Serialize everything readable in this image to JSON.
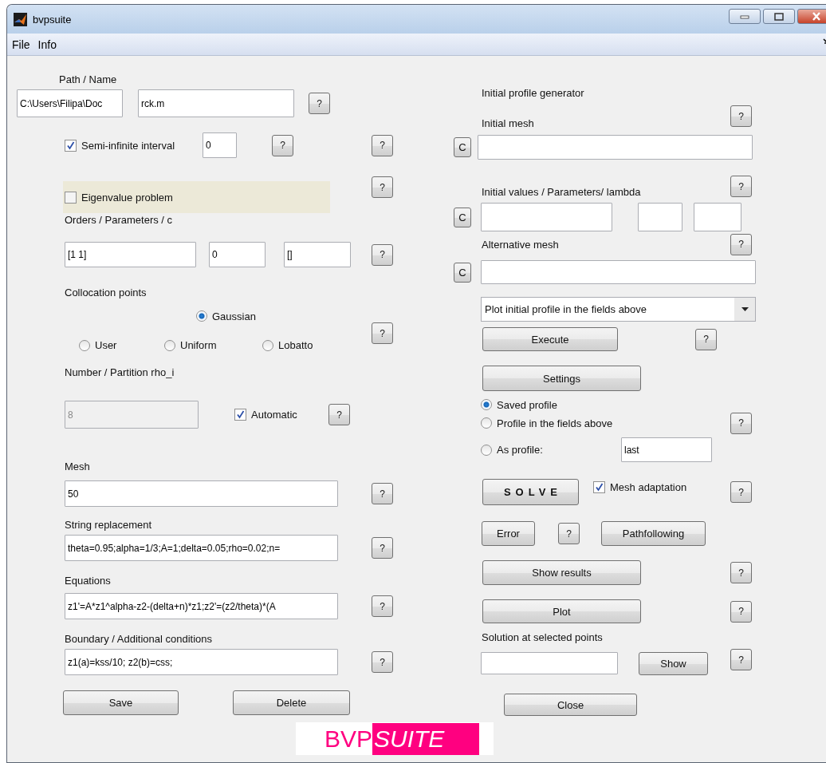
{
  "window": {
    "title": "bvpsuite"
  },
  "menu": [
    {
      "label": "File"
    },
    {
      "label": "Info"
    }
  ],
  "path_name": {
    "label": "Path / Name",
    "path": "C:\\Users\\Filipa\\Doc",
    "name": "rck.m",
    "help": "?"
  },
  "semi_infinite": {
    "label": "Semi-infinite interval",
    "checked": true,
    "value": "0",
    "help": "?",
    "help_2": "?"
  },
  "eigenvalue": {
    "label": "Eigenvalue problem",
    "checked": false,
    "help": "?"
  },
  "orders": {
    "label": "Orders / Parameters / c",
    "values": [
      "[1 1]",
      "0",
      "[]"
    ],
    "help": "?"
  },
  "collocation": {
    "label": "Collocation points",
    "help": "?",
    "options": [
      {
        "label": "Gaussian",
        "selected": true
      },
      {
        "label": "User",
        "selected": false
      },
      {
        "label": "Uniform",
        "selected": false
      },
      {
        "label": "Lobatto",
        "selected": false
      }
    ]
  },
  "partition": {
    "label": "Number / Partition rho_i",
    "value": "8",
    "disabled": true,
    "help": "?",
    "automatic": {
      "label": "Automatic",
      "checked": true
    }
  },
  "text_fields": [
    {
      "label": "Mesh",
      "value": "50",
      "help": "?"
    },
    {
      "label": "String replacement",
      "value": "theta=0.95;alpha=1/3;A=1;delta=0.05;rho=0.02;n=",
      "help": "?"
    },
    {
      "label": "Equations",
      "value": "z1'=A*z1^alpha-z2-(delta+n)*z1;z2'=(z2/theta)*(A",
      "help": "?"
    },
    {
      "label": "Boundary / Additional conditions",
      "value": "z1(a)=kss/10; z2(b)=css;",
      "help": "?"
    }
  ],
  "left_buttons": [
    {
      "label": "Save"
    },
    {
      "label": "Delete"
    }
  ],
  "logo": {
    "left": "BVP",
    "right": "SUITE"
  },
  "initial_profile": {
    "title": "Initial profile generator",
    "initial_mesh": {
      "label": "Initial mesh",
      "clear": "C",
      "help": "?"
    },
    "initial_values": {
      "label": "Initial values / Parameters/ lambda",
      "clear": "C",
      "help": "?"
    },
    "alternative_mesh": {
      "label": "Alternative mesh",
      "clear": "C",
      "help": "?"
    },
    "action": {
      "value": "Plot initial profile in the fields above"
    },
    "execute": {
      "label": "Execute",
      "help": "?"
    }
  },
  "settings": {
    "label": "Settings"
  },
  "profile_source": {
    "help": "?",
    "profile_name": "last",
    "options": [
      {
        "label": "Saved profile",
        "selected": true
      },
      {
        "label": "Profile in the fields above",
        "selected": false
      },
      {
        "label": "As profile:",
        "selected": false
      }
    ]
  },
  "solve": {
    "label": "SOLVE",
    "help": "?",
    "mesh_adaptation": {
      "label": "Mesh adaptation",
      "checked": true
    }
  },
  "error": {
    "label": "Error",
    "help": "?"
  },
  "pathfollowing": {
    "label": "Pathfollowing"
  },
  "show_results": {
    "label": "Show results",
    "help": "?"
  },
  "plot": {
    "label": "Plot",
    "help": "?"
  },
  "solution_points": {
    "label": "Solution at selected points",
    "button": "Show",
    "help": "?"
  },
  "close": {
    "label": "Close"
  }
}
